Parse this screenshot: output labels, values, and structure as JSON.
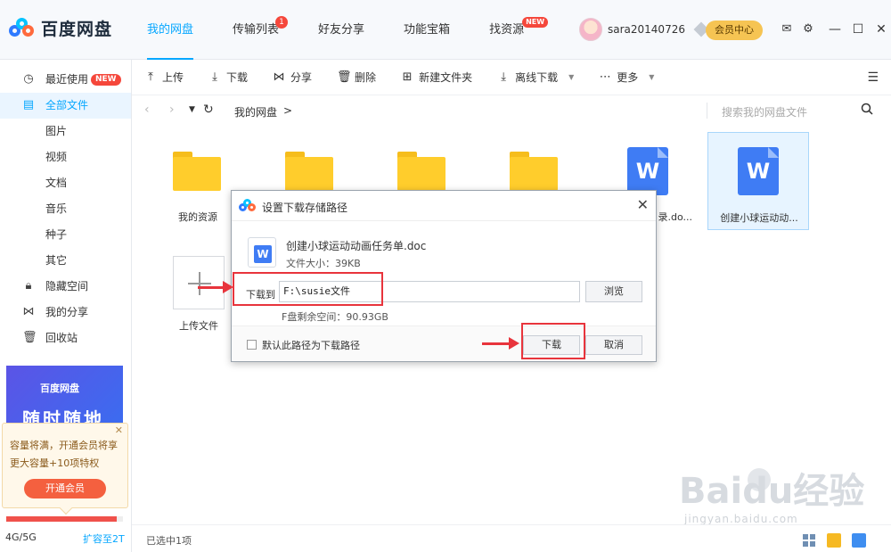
{
  "app": {
    "name": "百度网盘"
  },
  "nav": [
    {
      "label": "我的网盘",
      "active": true
    },
    {
      "label": "传输列表",
      "badge": "1"
    },
    {
      "label": "好友分享"
    },
    {
      "label": "功能宝箱"
    },
    {
      "label": "找资源",
      "tag": "NEW"
    }
  ],
  "user": {
    "name": "sara20140726",
    "vip_label": "会员中心"
  },
  "sidebar": {
    "items": [
      {
        "label": "最近使用",
        "icon": "clock-icon",
        "tag": "NEW"
      },
      {
        "label": "全部文件",
        "icon": "file-icon",
        "active": true
      }
    ],
    "subitems": [
      "图片",
      "视频",
      "文档",
      "音乐",
      "种子",
      "其它"
    ],
    "bottom_items": [
      {
        "label": "隐藏空间",
        "icon": "lock-icon"
      },
      {
        "label": "我的分享",
        "icon": "share-icon"
      },
      {
        "label": "回收站",
        "icon": "trash-icon"
      }
    ],
    "promo": {
      "brand": "百度网盘",
      "slogan": "随时随地"
    },
    "tip": {
      "text": "容量将满，开通会员将享更大容量+10项特权",
      "button": "开通会员"
    },
    "quota": {
      "used_text": "4G/5G",
      "fraction": 0.95,
      "expand": "扩容至2T"
    }
  },
  "toolbar": [
    "上传",
    "下载",
    "分享",
    "删除",
    "新建文件夹",
    "离线下载",
    "更多"
  ],
  "breadcrumb": {
    "path": "我的网盘",
    "sep": ">"
  },
  "search": {
    "placeholder": "搜索我的网盘文件"
  },
  "files": [
    {
      "name": "我的资源",
      "type": "folder"
    },
    {
      "name": "",
      "type": "folder"
    },
    {
      "name": "",
      "type": "folder"
    },
    {
      "name": "",
      "type": "folder"
    },
    {
      "name": "录.do...",
      "type": "word"
    },
    {
      "name": "创建小球运动动...",
      "type": "word",
      "selected": true
    }
  ],
  "upload": {
    "label": "上传文件"
  },
  "status": {
    "text": "已选中1项"
  },
  "watermark": {
    "brand": "Baidu经验",
    "url": "jingyan.baidu.com"
  },
  "dialog": {
    "title": "设置下载存储路径",
    "filename": "创建小球运动动画任务单.doc",
    "filesize": "文件大小：39KB",
    "path_label": "下载到",
    "path_value": "F:\\susie文件",
    "browse": "浏览",
    "free_space": "F盘剩余空间：90.93GB",
    "default_checkbox": "默认此路径为下载路径",
    "download": "下载",
    "cancel": "取消"
  },
  "colors": {
    "accent": "#06a7ff",
    "vip": "#f6c453",
    "annotation": "#e8343c"
  }
}
